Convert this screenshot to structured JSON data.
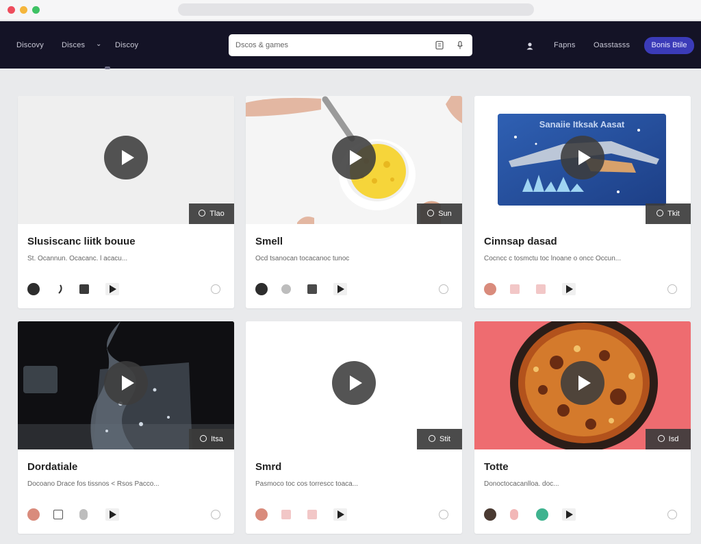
{
  "browser": {
    "url": ""
  },
  "nav": {
    "links": [
      "Discovy",
      "Disces",
      "Discoy"
    ],
    "search_placeholder": "Dscos & games",
    "right_links": [
      "Fapns",
      "Oasstasss"
    ],
    "cta_label": "Bonis Btile",
    "icons": [
      "user-icon",
      "dropdown-chevron-icon",
      "search-filter-icon",
      "search-mic-icon"
    ]
  },
  "colors": {
    "nav_bg": "#141326",
    "cta_bg": "#3b3bb8",
    "page_bg": "#e9eaec"
  },
  "cards": [
    {
      "title": "Slusiscanc liitk bouue",
      "desc": "St. Ocannun. Ocacanc. l acacu...",
      "badge": "Tlao",
      "thumb": "blank-gray"
    },
    {
      "title": "Smell",
      "desc": "Ocd tsanocan tocacanoc tunoc",
      "badge": "Sun",
      "thumb": "noodles-bowl"
    },
    {
      "title": "Cinnsap dasad",
      "desc": "Cocncc c tosmctu toc lnoane o oncc Occun...",
      "badge": "Tkit",
      "thumb": "illustration",
      "thumb_text": "Sanaiie Itksak Aasat"
    },
    {
      "title": "Dordatiale",
      "desc": "Docoano Drace fos tissnos < Rsos  Pacco...",
      "badge": "Itsa",
      "thumb": "water-glass"
    },
    {
      "title": "Smrd",
      "desc": "Pasmoco toc cos torrescc toaca...",
      "badge": "Stit",
      "thumb": "blank-white"
    },
    {
      "title": "Totte",
      "desc": "Donoctocacanlloa. doc...",
      "badge": "Isd",
      "thumb": "pizza-pan"
    }
  ]
}
